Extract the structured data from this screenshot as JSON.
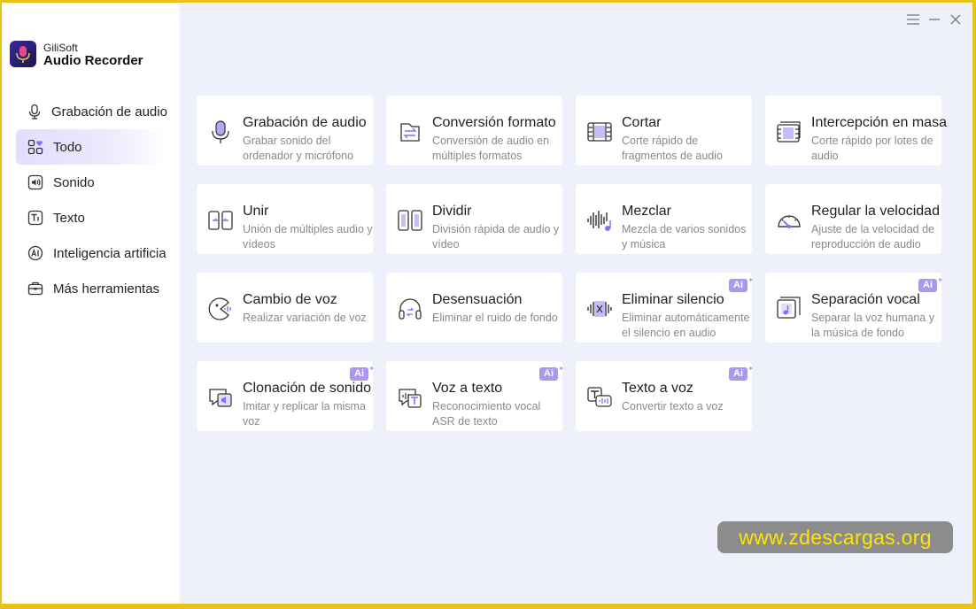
{
  "app": {
    "brand_small": "GiliSoft",
    "brand_big": "Audio Recorder"
  },
  "sidebar": {
    "items": [
      {
        "label": "Grabación de audio",
        "icon": "microphone-icon",
        "active": false
      },
      {
        "label": "Todo",
        "icon": "grid-heart-icon",
        "active": true
      },
      {
        "label": "Sonido",
        "icon": "speaker-icon",
        "active": false
      },
      {
        "label": "Texto",
        "icon": "text-icon",
        "active": false
      },
      {
        "label": "Inteligencia artificia",
        "icon": "ai-icon",
        "active": false
      },
      {
        "label": "Más herramientas",
        "icon": "toolbox-icon",
        "active": false
      }
    ]
  },
  "window_controls": [
    "menu-icon",
    "minimize-icon",
    "close-icon"
  ],
  "tools": [
    {
      "title": "Grabación de audio",
      "desc": "Grabar sonido del ordenador y micrófono",
      "icon": "microphone-icon",
      "ai": false
    },
    {
      "title": "Conversión formato",
      "desc": "Conversión de audio en múltiples formatos",
      "icon": "convert-icon",
      "ai": false
    },
    {
      "title": "Cortar",
      "desc": "Corte rápido de fragmentos de audio",
      "icon": "film-cut-icon",
      "ai": false
    },
    {
      "title": "Intercepción en masa",
      "desc": "Corte rápido por lotes de audio",
      "icon": "batch-cut-icon",
      "ai": false
    },
    {
      "title": "Unir",
      "desc": "Unión de múltiples audio y vídeos",
      "icon": "merge-icon",
      "ai": false
    },
    {
      "title": "Dividir",
      "desc": "División rápida de audio y vídeo",
      "icon": "split-icon",
      "ai": false
    },
    {
      "title": "Mezclar",
      "desc": "Mezcla de varios sonidos y música",
      "icon": "mix-icon",
      "ai": false
    },
    {
      "title": "Regular la velocidad",
      "desc": "Ajuste de la velocidad de reproducción de audio",
      "icon": "speedometer-icon",
      "ai": false
    },
    {
      "title": "Cambio de voz",
      "desc": "Realizar variación de voz",
      "icon": "voice-change-icon",
      "ai": false
    },
    {
      "title": "Desensuación",
      "desc": "Eliminar el ruido de fondo",
      "icon": "headphones-icon",
      "ai": false
    },
    {
      "title": "Eliminar silencio",
      "desc": "Eliminar automáticamente el silencio en audio",
      "icon": "silence-remove-icon",
      "ai": true
    },
    {
      "title": "Separación vocal",
      "desc": "Separar la voz humana y la música de fondo",
      "icon": "vocal-separation-icon",
      "ai": true
    },
    {
      "title": "Clonación de sonido",
      "desc": "Imitar y replicar la misma voz",
      "icon": "voice-clone-icon",
      "ai": true
    },
    {
      "title": "Voz a texto",
      "desc": "Reconocimiento vocal ASR de texto",
      "icon": "speech-to-text-icon",
      "ai": true
    },
    {
      "title": "Texto a voz",
      "desc": "Convertir texto a voz",
      "icon": "text-to-speech-icon",
      "ai": true
    }
  ],
  "ai_badge_label": "Ai",
  "watermark": "www.zdescargas.org",
  "colors": {
    "accent": "#a997f2",
    "active_nav": "#e3defc",
    "watermark_text": "#ffe600"
  }
}
